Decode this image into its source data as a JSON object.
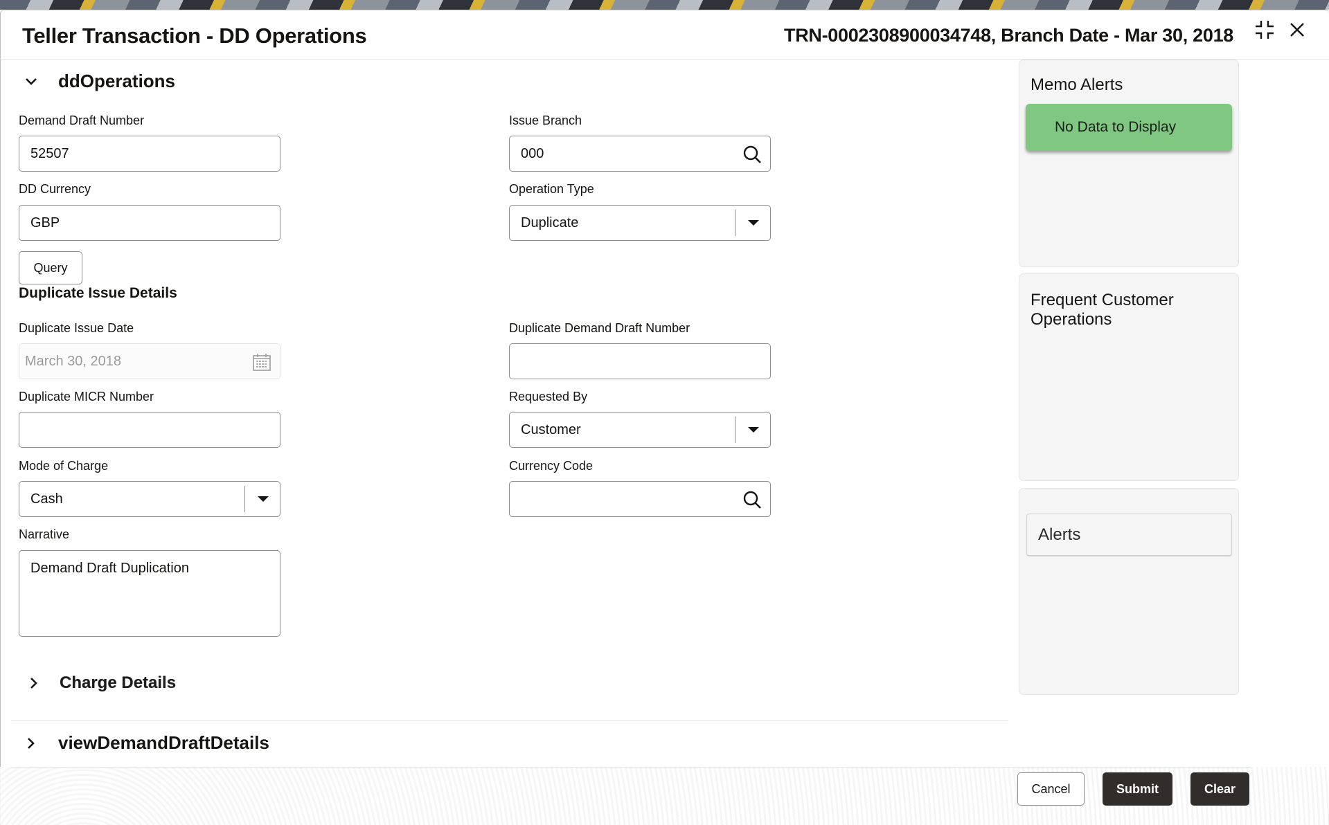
{
  "header": {
    "title": "Teller Transaction - DD Operations",
    "reference": "TRN-0002308900034748, Branch Date - Mar 30, 2018",
    "icons": [
      "collapse-icon",
      "close-icon"
    ]
  },
  "sections": {
    "dd_operations": {
      "label": "ddOperations",
      "expanded": true
    },
    "charge_details": {
      "label": "Charge Details",
      "expanded": false
    },
    "view_demand_draft_details": {
      "label": "viewDemandDraftDetails",
      "expanded": false
    }
  },
  "form": {
    "demand_draft_number": {
      "label": "Demand Draft Number",
      "value": "52507"
    },
    "issue_branch": {
      "label": "Issue Branch",
      "value": "000",
      "icon": "search-icon"
    },
    "dd_currency": {
      "label": "DD Currency",
      "value": "GBP"
    },
    "operation_type": {
      "label": "Operation Type",
      "value": "Duplicate"
    },
    "query_button": "Query",
    "duplicate_issue_details_heading": "Duplicate Issue Details",
    "duplicate_issue_date": {
      "label": "Duplicate Issue Date",
      "value": "March 30, 2018",
      "icon": "calendar-icon",
      "disabled": true
    },
    "duplicate_demand_draft_number": {
      "label": "Duplicate Demand Draft Number",
      "value": ""
    },
    "duplicate_micr_number": {
      "label": "Duplicate MICR Number",
      "value": ""
    },
    "requested_by": {
      "label": "Requested By",
      "value": "Customer"
    },
    "mode_of_charge": {
      "label": "Mode of Charge",
      "value": "Cash"
    },
    "currency_code": {
      "label": "Currency Code",
      "value": "",
      "icon": "search-icon"
    },
    "narrative": {
      "label": "Narrative",
      "value": "Demand Draft Duplication"
    }
  },
  "side_panels": {
    "memo_alerts": {
      "title": "Memo Alerts",
      "message": "No Data to Display",
      "message_color": "#80c882"
    },
    "frequent_customer_operations": {
      "title": "Frequent Customer Operations"
    },
    "alerts": {
      "title": "Alerts"
    }
  },
  "footer": {
    "cancel": "Cancel",
    "submit": "Submit",
    "clear": "Clear"
  }
}
